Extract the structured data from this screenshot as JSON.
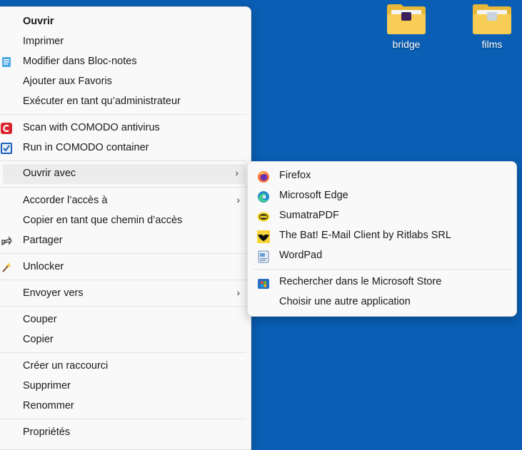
{
  "desktop": {
    "icons": [
      {
        "label": "bridge"
      },
      {
        "label": "films"
      }
    ]
  },
  "context_menu": {
    "items": [
      {
        "label": "Ouvrir",
        "bold": true
      },
      {
        "label": "Imprimer"
      },
      {
        "label": "Modifier dans Bloc-notes",
        "icon": "notepad-icon"
      },
      {
        "label": "Ajouter aux Favoris"
      },
      {
        "label": "Exécuter en tant qu’administrateur"
      },
      {
        "label": "Scan with COMODO antivirus",
        "icon": "comodo-icon"
      },
      {
        "label": "Run in COMODO container",
        "icon": "comodo-container-icon"
      },
      {
        "label": "Ouvrir avec",
        "submenu": true,
        "highlighted": true
      },
      {
        "label": "Accorder l’accès à",
        "submenu": true
      },
      {
        "label": "Copier en tant que chemin d’accès"
      },
      {
        "label": "Partager",
        "icon": "share-icon"
      },
      {
        "label": "Unlocker",
        "icon": "unlocker-wand-icon"
      },
      {
        "label": "Envoyer vers",
        "submenu": true
      },
      {
        "label": "Couper"
      },
      {
        "label": "Copier"
      },
      {
        "label": "Créer un raccourci"
      },
      {
        "label": "Supprimer"
      },
      {
        "label": "Renommer"
      },
      {
        "label": "Propriétés"
      }
    ]
  },
  "open_with_submenu": {
    "items": [
      {
        "label": "Firefox",
        "icon": "firefox-icon"
      },
      {
        "label": "Microsoft Edge",
        "icon": "edge-icon"
      },
      {
        "label": "SumatraPDF",
        "icon": "sumatrapdf-icon"
      },
      {
        "label": "The Bat! E-Mail Client by Ritlabs SRL",
        "icon": "the-bat-icon"
      },
      {
        "label": "WordPad",
        "icon": "wordpad-icon"
      },
      {
        "label": "Rechercher dans le Microsoft Store",
        "icon": "microsoft-store-icon"
      },
      {
        "label": "Choisir une autre application"
      }
    ]
  },
  "chevron_glyph": "›"
}
